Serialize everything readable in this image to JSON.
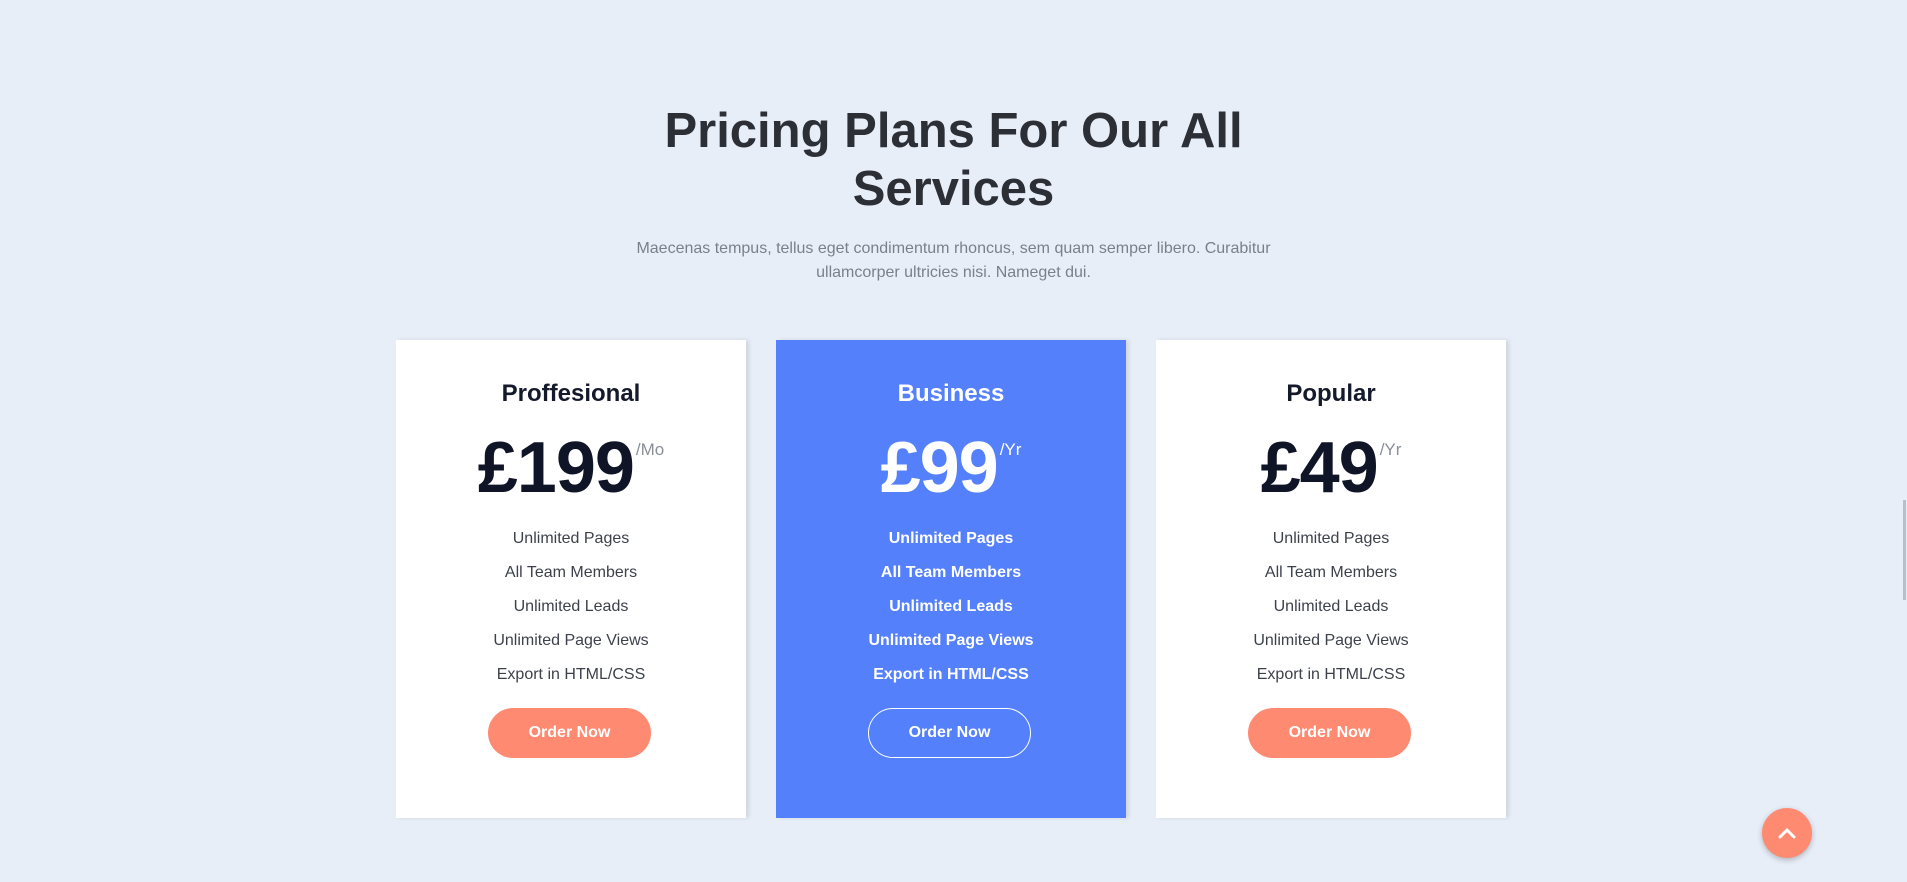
{
  "section": {
    "title_line1": "Pricing Plans For Our All",
    "title_line2": "Services",
    "subtitle_line1": "Maecenas tempus, tellus eget condimentum rhoncus, sem quam semper libero. Curabitur",
    "subtitle_line2": "ullamcorper ultricies nisi. Nameget dui."
  },
  "plans": [
    {
      "name": "Proffesional",
      "price": "£199",
      "period": "/Mo",
      "features": [
        "Unlimited Pages",
        "All Team Members",
        "Unlimited Leads",
        "Unlimited Page Views",
        "Export in HTML/CSS"
      ],
      "button": "Order Now",
      "featured": false
    },
    {
      "name": "Business",
      "price": "£99",
      "period": "/Yr",
      "features": [
        "Unlimited Pages",
        "All Team Members",
        "Unlimited Leads",
        "Unlimited Page Views",
        "Export in HTML/CSS"
      ],
      "button": "Order Now",
      "featured": true
    },
    {
      "name": "Popular",
      "price": "£49",
      "period": "/Yr",
      "features": [
        "Unlimited Pages",
        "All Team Members",
        "Unlimited Leads",
        "Unlimited Page Views",
        "Export in HTML/CSS"
      ],
      "button": "Order Now",
      "featured": false
    }
  ],
  "scroll_top": {
    "icon": "chevron-up-icon"
  },
  "colors": {
    "background": "#e8eef8",
    "featured_card": "#5580fb",
    "button_accent": "#fe8a71",
    "heading": "#2d2f36",
    "text_muted": "#7b7f8a"
  }
}
